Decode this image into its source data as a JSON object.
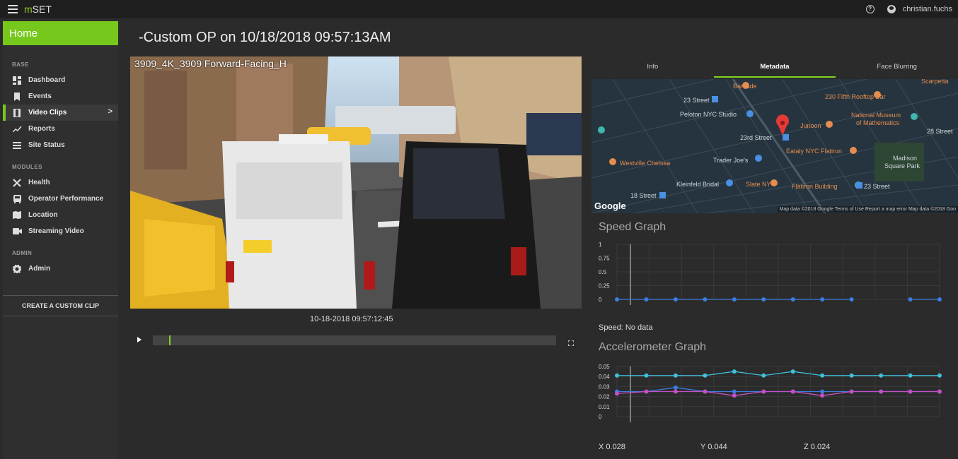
{
  "app": {
    "brand_prefix": "m",
    "brand_suffix": "SET",
    "user": "christian.fuchs"
  },
  "sidebar": {
    "home": "Home",
    "sections": {
      "base": "BASE",
      "modules": "MODULES",
      "admin": "ADMIN"
    },
    "items": {
      "dashboard": "Dashboard",
      "events": "Events",
      "video_clips": "Video Clips",
      "reports": "Reports",
      "site_status": "Site Status",
      "health": "Health",
      "operator_performance": "Operator Performance",
      "location": "Location",
      "streaming_video": "Streaming Video",
      "admin": "Admin"
    },
    "create_clip": "CREATE A CUSTOM CLIP"
  },
  "page": {
    "title": "-Custom OP on 10/18/2018 09:57:13AM",
    "video_caption": "3909_4K_3909 Forward-Facing_H",
    "timestamp": "10-18-2018 09:57:12:45",
    "progress": 0.04
  },
  "tabs": [
    "Info",
    "Metadata",
    "Face Blurring"
  ],
  "active_tab": "Metadata",
  "map": {
    "labels": {
      "barcade": "Barcade",
      "scarpetta": "Scarpetta",
      "st23": "23 Street",
      "fifth_rooftop": "230 Fifth Rooftop Bar",
      "peloton": "Peloton NYC Studio",
      "math_museum_1": "National Museum",
      "math_museum_2": "of Mathematics",
      "junoon": "Junoon",
      "st28": "28 Street",
      "rd23": "23rd Street",
      "eataly": "Eataly NYC Flatiron",
      "westville": "Westville Chelsea",
      "trader": "Trader Joe's",
      "madison_1": "Madison",
      "madison_2": "Square Park",
      "kleinfeld": "Kleinfeld Bridal",
      "slate": "Slate NY",
      "flatiron": "Flatiron Building",
      "st23b": "23 Street",
      "st18": "18 Street"
    },
    "google": "Google",
    "attribution": "Map data ©2018 Google   Terms of Use   Report a map error  Map data ©2018 Goo"
  },
  "speed": {
    "title": "Speed Graph",
    "status": "Speed: No data"
  },
  "accel": {
    "title": "Accelerometer Graph",
    "x": "X 0.028",
    "y": "Y 0.044",
    "z": "Z 0.024"
  },
  "chart_data": [
    {
      "type": "line",
      "title": "Speed Graph",
      "y_ticks": [
        "1",
        "0.75",
        "0.5",
        "0.25",
        "0"
      ],
      "ylim": [
        0,
        1
      ],
      "series": [
        {
          "color": "#3b7de0",
          "values": [
            0,
            0,
            0,
            0,
            0,
            0,
            0,
            0,
            0,
            null,
            0,
            0
          ]
        }
      ]
    },
    {
      "type": "line",
      "title": "Accelerometer Graph",
      "y_ticks": [
        "0.05",
        "0.04",
        "0.03",
        "0.02",
        "0.01",
        "0"
      ],
      "ylim": [
        0,
        0.05
      ],
      "series": [
        {
          "color": "#3fc1dc",
          "values": [
            0.041,
            0.041,
            0.041,
            0.041,
            0.045,
            0.041,
            0.045,
            0.041,
            0.041,
            0.041,
            0.041,
            0.041
          ]
        },
        {
          "color": "#3b7de0",
          "values": [
            0.025,
            0.025,
            0.029,
            0.025,
            0.025,
            0.025,
            0.025,
            0.025,
            0.025,
            0.025,
            0.025,
            0.025
          ]
        },
        {
          "color": "#c64fc6",
          "values": [
            0.023,
            0.025,
            0.025,
            0.025,
            0.021,
            0.025,
            0.025,
            0.021,
            0.025,
            0.025,
            0.025,
            0.025
          ]
        }
      ]
    }
  ]
}
